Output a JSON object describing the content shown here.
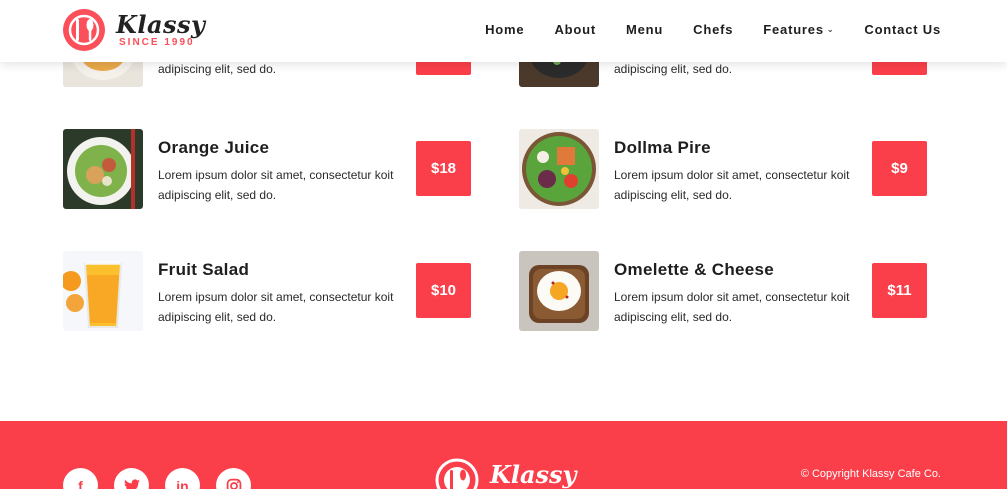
{
  "brand": {
    "name": "Klassy",
    "since": "SINCE 1990",
    "accent": "#fb3f4a"
  },
  "nav": {
    "items": [
      {
        "label": "Home"
      },
      {
        "label": "About"
      },
      {
        "label": "Menu"
      },
      {
        "label": "Chefs"
      },
      {
        "label": "Features",
        "has_dropdown": true
      },
      {
        "label": "Contact Us"
      }
    ]
  },
  "partial_row": {
    "left_desc": "adipiscing elit, sed do.",
    "right_desc": "adipiscing elit, sed do."
  },
  "menu": {
    "items": [
      {
        "name": "Orange Juice",
        "desc_line1": "Lorem ipsum dolor sit amet, consectetur koit",
        "desc_line2": "adipiscing elit, sed do.",
        "price": "$18",
        "image": "salad-bowl"
      },
      {
        "name": "Dollma Pire",
        "desc_line1": "Lorem ipsum dolor sit amet, consectetur koit",
        "desc_line2": "adipiscing elit, sed do.",
        "price": "$9",
        "image": "veggie-bowl"
      },
      {
        "name": "Fruit Salad",
        "desc_line1": "Lorem ipsum dolor sit amet, consectetur koit",
        "desc_line2": "adipiscing elit, sed do.",
        "price": "$10",
        "image": "orange-juice-glass"
      },
      {
        "name": "Omelette & Cheese",
        "desc_line1": "Lorem ipsum dolor sit amet, consectetur koit",
        "desc_line2": "adipiscing elit, sed do.",
        "price": "$11",
        "image": "egg-toast"
      }
    ]
  },
  "footer": {
    "socials": [
      {
        "icon": "facebook-icon",
        "glyph": "f"
      },
      {
        "icon": "twitter-icon",
        "glyph": "t"
      },
      {
        "icon": "linkedin-icon",
        "glyph": "in"
      },
      {
        "icon": "instagram-icon",
        "glyph": "◎"
      }
    ],
    "logo": "Klassy",
    "copyright": "© Copyright Klassy Cafe Co."
  }
}
